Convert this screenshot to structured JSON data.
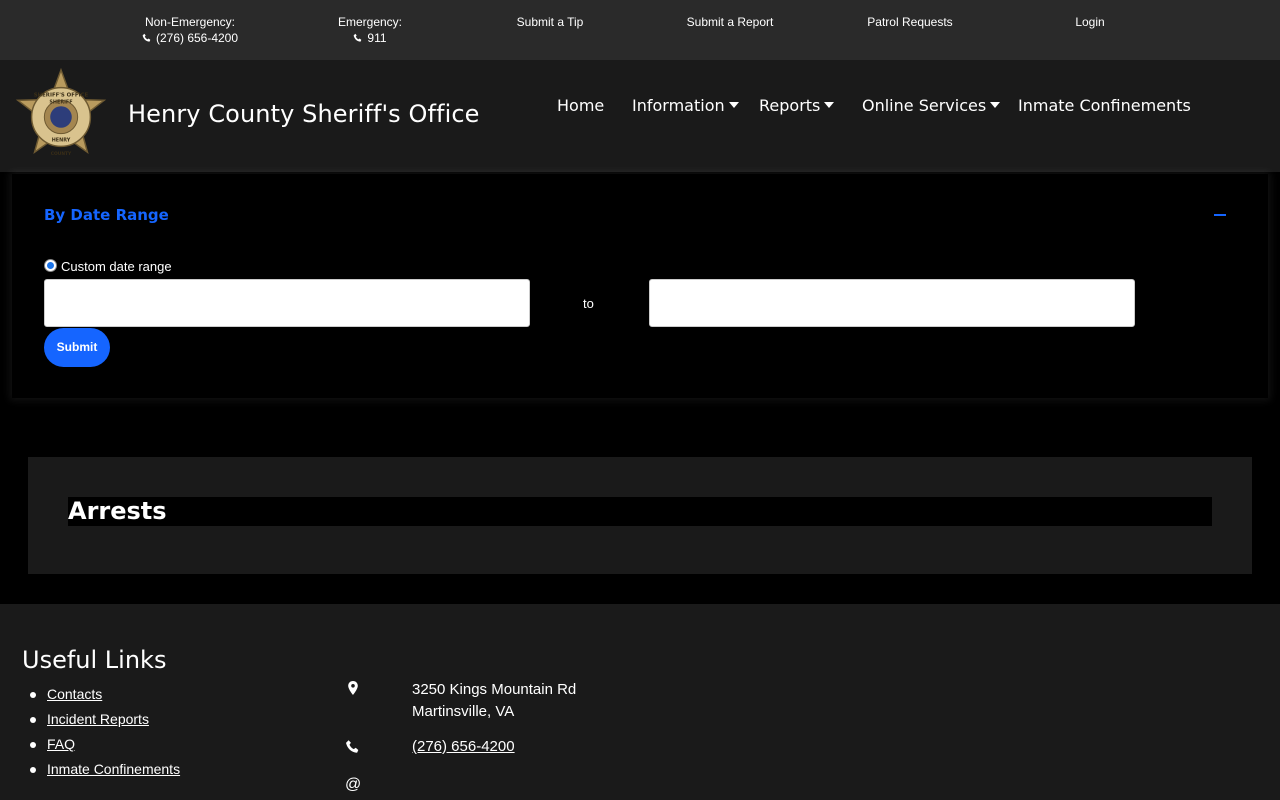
{
  "topbar": {
    "non_emergency_label": "Non-Emergency:",
    "non_emergency_phone": "(276) 656-4200",
    "emergency_label": "Emergency:",
    "emergency_phone": "911",
    "submit_tip": "Submit a Tip",
    "submit_report": "Submit a Report",
    "patrol_requests": "Patrol Requests",
    "login": "Login"
  },
  "header": {
    "site_title": "Henry County Sheriff's Office",
    "logo_text_top": "SHERIFF'S OFFICE",
    "logo_text_mid": "SHERIFF",
    "logo_text_bottom": "HENRY",
    "logo_text_county": "COUNTY",
    "nav": {
      "home": "Home",
      "information": "Information",
      "reports": "Reports",
      "online_services": "Online Services",
      "inmate_confinements": "Inmate Confinements"
    }
  },
  "date_panel": {
    "title": "By Date Range",
    "radio_label": "Custom date range",
    "start_value": "",
    "to_label": "to",
    "end_value": "",
    "submit": "Submit"
  },
  "arrests": {
    "title": "Arrests"
  },
  "footer": {
    "heading": "Useful Links",
    "links": [
      "Contacts",
      "Incident Reports",
      "FAQ",
      "Inmate Confinements"
    ],
    "address_line1": "3250 Kings Mountain Rd",
    "address_line2": "Martinsville, VA",
    "phone": "(276) 656-4200",
    "email_icon": "@"
  },
  "icons": {
    "phone": "phone-icon",
    "map_marker": "map-marker-icon",
    "caret": "caret-down-icon",
    "collapse": "minus-icon"
  },
  "colors": {
    "accent": "#1565ff",
    "topbar_bg": "#2a2a2a",
    "header_bg": "#1a1a1a",
    "body_bg": "#000000"
  }
}
